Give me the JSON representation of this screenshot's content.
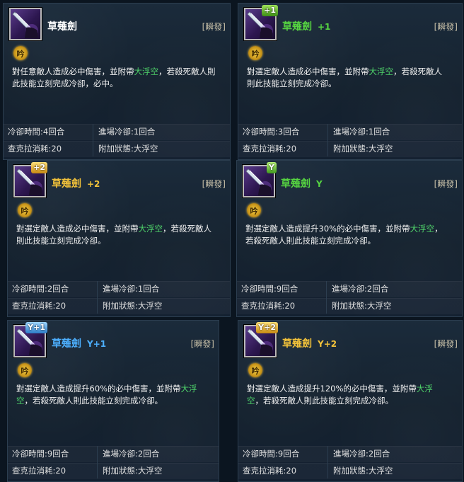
{
  "colors": {
    "title_white": "#ffffff",
    "title_green": "#56d441",
    "title_yellow": "#f2c23a",
    "title_blue": "#4db0ff",
    "highlight": "#4fd36a"
  },
  "stamp_char": "吟",
  "cards": [
    {
      "title": "草薙劍",
      "suffix": "",
      "title_color": "#ffffff",
      "badge": "",
      "badge_class": "",
      "cast": "[瞬發]",
      "desc_before": "對任意敵人造成必中傷害，並附帶",
      "desc_hl": "大浮空",
      "desc_after": "，若殺死敵人則此技能立刻完成冷卻，必中。",
      "stats": {
        "cooldown_label": "冷卻時間:",
        "cooldown_value": "4回合",
        "entry_cd_label": "進場冷卻:",
        "entry_cd_value": "1回合",
        "chakra_label": "查克拉消耗:",
        "chakra_value": "20",
        "effect_label": "附加狀態:",
        "effect_value": "大浮空"
      }
    },
    {
      "title": "草薙劍",
      "suffix": "+1",
      "title_color": "#56d441",
      "badge": "+1",
      "badge_class": "badge-green",
      "cast": "[瞬發]",
      "desc_before": "對選定敵人造成必中傷害，並附帶",
      "desc_hl": "大浮空",
      "desc_after": "，若殺死敵人則此技能立刻完成冷卻。",
      "stats": {
        "cooldown_label": "冷卻時間:",
        "cooldown_value": "3回合",
        "entry_cd_label": "進場冷卻:",
        "entry_cd_value": "1回合",
        "chakra_label": "查克拉消耗:",
        "chakra_value": "20",
        "effect_label": "附加狀態:",
        "effect_value": "大浮空"
      }
    },
    {
      "title": "草薙劍",
      "suffix": "+2",
      "title_color": "#f2c23a",
      "badge": "+2",
      "badge_class": "badge-yellow",
      "cast": "[瞬發]",
      "desc_before": "對選定敵人造成必中傷害，並附帶",
      "desc_hl": "大浮空",
      "desc_after": "，若殺死敵人則此技能立刻完成冷卻。",
      "stats": {
        "cooldown_label": "冷卻時間:",
        "cooldown_value": "2回合",
        "entry_cd_label": "進場冷卻:",
        "entry_cd_value": "1回合",
        "chakra_label": "查克拉消耗:",
        "chakra_value": "20",
        "effect_label": "附加狀態:",
        "effect_value": "大浮空"
      }
    },
    {
      "title": "草薙劍",
      "suffix": "Y",
      "title_color": "#56d441",
      "badge": "Y",
      "badge_class": "badge-y",
      "cast": "[瞬發]",
      "desc_before": "對選定敵人造成提升30%的必中傷害，並附帶",
      "desc_hl": "大浮空",
      "desc_after": "，若殺死敵人則此技能立刻完成冷卻。",
      "stats": {
        "cooldown_label": "冷卻時間:",
        "cooldown_value": "9回合",
        "entry_cd_label": "進場冷卻:",
        "entry_cd_value": "2回合",
        "chakra_label": "查克拉消耗:",
        "chakra_value": "20",
        "effect_label": "附加狀態:",
        "effect_value": "大浮空"
      }
    },
    {
      "title": "草薙劍",
      "suffix": "Y+1",
      "title_color": "#4db0ff",
      "badge": "Y+1",
      "badge_class": "badge-blue",
      "cast": "[瞬發]",
      "desc_before": "對選定敵人造成提升60%的必中傷害，並附帶",
      "desc_hl": "大浮空",
      "desc_after": "，若殺死敵人則此技能立刻完成冷卻。",
      "stats": {
        "cooldown_label": "冷卻時間:",
        "cooldown_value": "9回合",
        "entry_cd_label": "進場冷卻:",
        "entry_cd_value": "2回合",
        "chakra_label": "查克拉消耗:",
        "chakra_value": "20",
        "effect_label": "附加狀態:",
        "effect_value": "大浮空"
      }
    },
    {
      "title": "草薙劍",
      "suffix": "Y+2",
      "title_color": "#f2c23a",
      "badge": "Y+2",
      "badge_class": "badge-yellow",
      "cast": "[瞬發]",
      "desc_before": "對選定敵人造成提升120%的必中傷害，並附帶",
      "desc_hl": "大浮空",
      "desc_after": "，若殺死敵人則此技能立刻完成冷卻。",
      "stats": {
        "cooldown_label": "冷卻時間:",
        "cooldown_value": "9回合",
        "entry_cd_label": "進場冷卻:",
        "entry_cd_value": "2回合",
        "chakra_label": "查克拉消耗:",
        "chakra_value": "20",
        "effect_label": "附加狀態:",
        "effect_value": "大浮空"
      }
    }
  ]
}
